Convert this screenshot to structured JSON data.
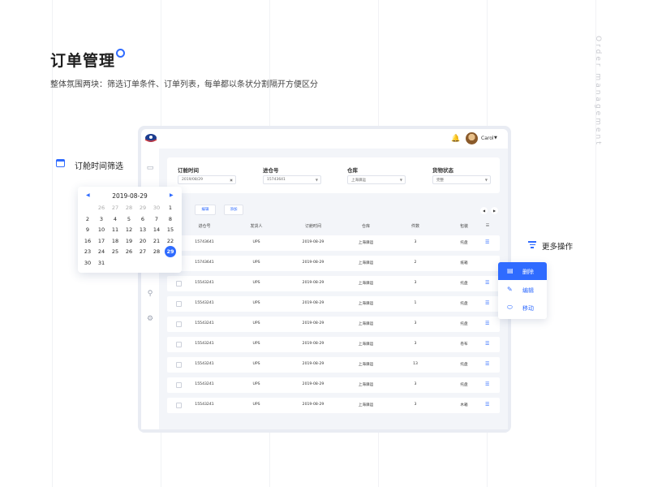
{
  "page": {
    "title": "订单管理",
    "subtitle": "整体氛围两块：筛选订单条件、订单列表，每单都以条状分割隔开方便区分",
    "vertical_text": "Order management"
  },
  "app": {
    "user": "Carol",
    "filters": [
      {
        "label": "订舱时间",
        "value": "2019/08/29"
      },
      {
        "label": "进仓号",
        "value": "15743641"
      },
      {
        "label": "仓库",
        "value": "上海驿运"
      },
      {
        "label": "货物状态",
        "value": "完整"
      }
    ],
    "buttons": {
      "edit": "编辑",
      "add": "添加"
    },
    "columns": [
      "进仓号",
      "发货人",
      "订舱时间",
      "仓库",
      "件数",
      "包装"
    ],
    "rows": [
      [
        "15743641",
        "UPS",
        "2019-08-29",
        "上海驿运",
        "3",
        "托盘"
      ],
      [
        "15743641",
        "UPS",
        "2019-08-29",
        "上海驿运",
        "2",
        "纸箱"
      ],
      [
        "15543241",
        "UPS",
        "2019-08-29",
        "上海驿运",
        "3",
        "托盘"
      ],
      [
        "15543241",
        "UPS",
        "2019-08-29",
        "上海驿运",
        "1",
        "托盘"
      ],
      [
        "15543241",
        "UPS",
        "2019-08-29",
        "上海驿运",
        "3",
        "托盘"
      ],
      [
        "15543241",
        "UPS",
        "2019-08-29",
        "上海驿运",
        "3",
        "卷布"
      ],
      [
        "15543241",
        "UPS",
        "2019-08-29",
        "上海驿运",
        "13",
        "托盘"
      ],
      [
        "15543241",
        "UPS",
        "2019-08-29",
        "上海驿运",
        "3",
        "托盘"
      ],
      [
        "15543241",
        "UPS",
        "2019-08-29",
        "上海驿运",
        "3",
        "木箱"
      ]
    ]
  },
  "calendar": {
    "label": "订舱时间筛选",
    "title": "2019-08-29",
    "weeks": [
      [
        "",
        "26",
        "27",
        "28",
        "29",
        "30",
        "1"
      ],
      [
        "2",
        "3",
        "4",
        "5",
        "6",
        "7",
        "8"
      ],
      [
        "9",
        "10",
        "11",
        "12",
        "13",
        "14",
        "15"
      ],
      [
        "16",
        "17",
        "18",
        "19",
        "20",
        "21",
        "22"
      ],
      [
        "23",
        "24",
        "25",
        "26",
        "27",
        "28",
        "29"
      ],
      [
        "30",
        "31",
        "",
        "",
        "",
        "",
        ""
      ]
    ],
    "selected": "29"
  },
  "more_ops": {
    "label": "更多操作",
    "items": [
      {
        "label": "删除",
        "icon": "clipboard-icon"
      },
      {
        "label": "编辑",
        "icon": "pen-icon"
      },
      {
        "label": "移动",
        "icon": "mouse-icon"
      }
    ]
  },
  "colors": {
    "accent": "#2f6bff"
  }
}
